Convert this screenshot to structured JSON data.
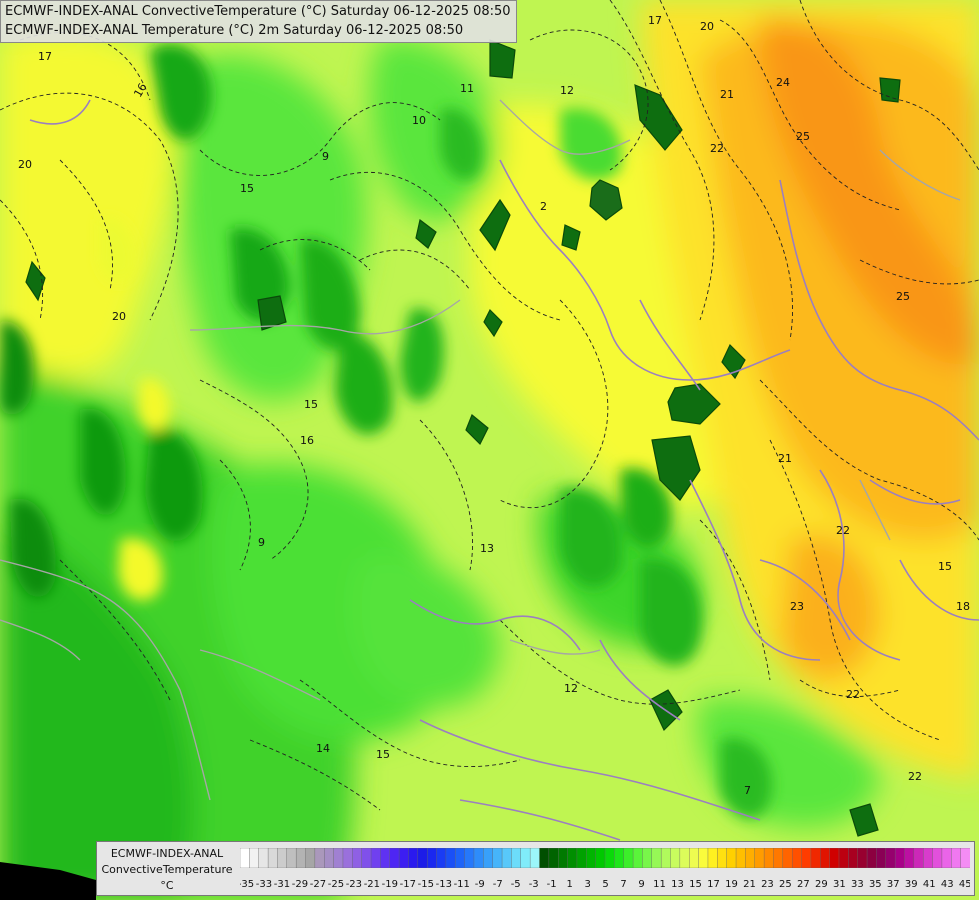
{
  "titles": {
    "line1": "ECMWF-INDEX-ANAL ConvectiveTemperature (°C) Saturday 06-12-2025 08:50",
    "line2": "ECMWF-INDEX-ANAL Temperature (°C) 2m Saturday 06-12-2025 08:50"
  },
  "legend": {
    "model": "ECMWF-INDEX-ANAL",
    "parameter": "ConvectiveTemperature",
    "unit": "°C",
    "tick_labels": [
      "-35",
      "-33",
      "-31",
      "-29",
      "-27",
      "-25",
      "-23",
      "-21",
      "-19",
      "-17",
      "-15",
      "-13",
      "-11",
      "-9",
      "-7",
      "-5",
      "-3",
      "-1",
      "1",
      "3",
      "5",
      "7",
      "9",
      "11",
      "13",
      "15",
      "17",
      "19",
      "21",
      "23",
      "25",
      "27",
      "29",
      "31",
      "33",
      "35",
      "37",
      "39",
      "41",
      "43",
      "45"
    ],
    "swatch_colors": [
      "#ffffff",
      "#f2f2f2",
      "#e6e6e6",
      "#d9d9d9",
      "#cccccc",
      "#bfbfbf",
      "#b3b3b3",
      "#a6a6a6",
      "#aa98bb",
      "#a58ec5",
      "#a080d2",
      "#9a70dc",
      "#8f60e4",
      "#8050ea",
      "#7040ef",
      "#5f32f2",
      "#4e26f3",
      "#3c1ef2",
      "#2a1aee",
      "#1c1ce8",
      "#1a28f0",
      "#1a3cf4",
      "#1a50f6",
      "#1e64f8",
      "#2678fa",
      "#2e8cfa",
      "#38a0fa",
      "#46b4fa",
      "#58c8fa",
      "#6cdcfa",
      "#80ecfa",
      "#9cf6fa",
      "#004f00",
      "#006400",
      "#007a00",
      "#008f00",
      "#00a200",
      "#00b500",
      "#00c800",
      "#0ad90a",
      "#1ee61a",
      "#3cee2a",
      "#5af43a",
      "#78f64a",
      "#96f856",
      "#b0fa5c",
      "#c8fc5e",
      "#dcfc5a",
      "#eefc50",
      "#fafc3c",
      "#fff020",
      "#ffe010",
      "#ffd000",
      "#ffbf00",
      "#ffae00",
      "#ff9c00",
      "#ff8a00",
      "#ff7800",
      "#ff6400",
      "#ff5000",
      "#ff3c00",
      "#f02800",
      "#e01400",
      "#d00000",
      "#bc0010",
      "#a80020",
      "#980030",
      "#8c0040",
      "#8a0055",
      "#96006e",
      "#a80088",
      "#bc10a2",
      "#cc28b8",
      "#d83ccc",
      "#e250dc",
      "#ea64e8",
      "#f078f0",
      "#f48cf4"
    ]
  },
  "contour_labels": [
    "17",
    "16",
    "20",
    "15",
    "10",
    "9",
    "12",
    "11",
    "17",
    "20",
    "21",
    "22",
    "24",
    "25",
    "25",
    "21",
    "22",
    "23",
    "22",
    "15",
    "16",
    "9",
    "12",
    "15",
    "14",
    "13",
    "7",
    "2",
    "15",
    "18",
    "22",
    "20"
  ],
  "colors": {
    "land_green": "#59e63a",
    "deep_green": "#1fb81a",
    "dark_green": "#0e8f0e",
    "lime": "#b4f645",
    "yellow": "#f2fa2e",
    "orange": "#fcb41c",
    "dark_orange": "#f98a12",
    "border": "#9b7fc0",
    "coast": "#a6a6a6",
    "isoline": "#222222"
  }
}
